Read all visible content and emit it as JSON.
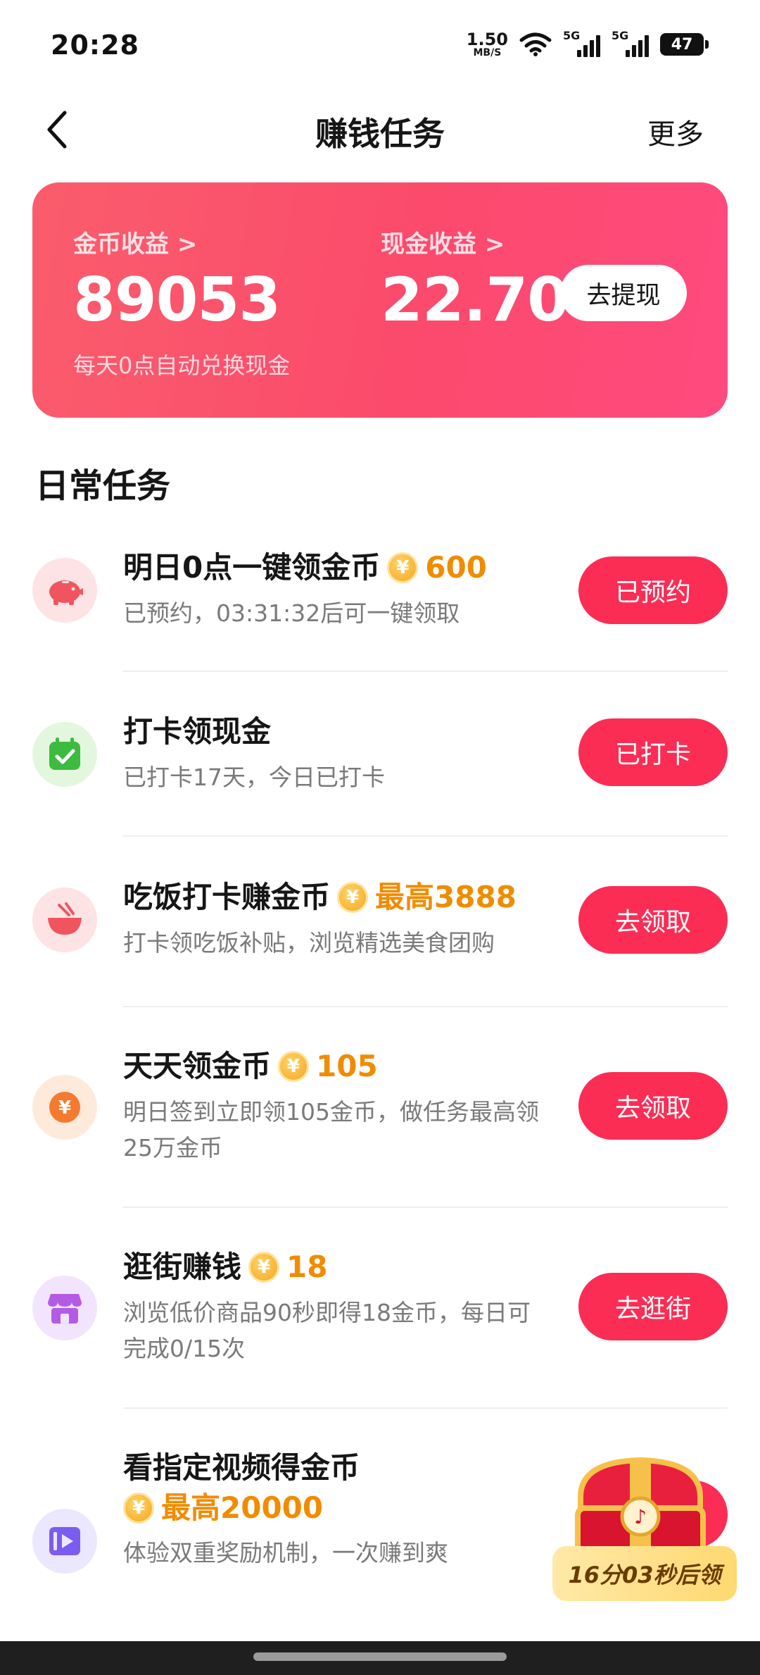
{
  "status_bar": {
    "time": "20:28",
    "net_speed_value": "1.50",
    "net_speed_unit": "MB/S",
    "sim1_label": "5G",
    "sim2_label": "5G",
    "battery": "47"
  },
  "nav": {
    "title": "赚钱任务",
    "more": "更多",
    "back_icon": "chevron-left-icon"
  },
  "earnings": {
    "coin_label": "金币收益 >",
    "coin_value": "89053",
    "cash_label": "现金收益 >",
    "cash_value": "22.70",
    "withdraw_button": "去提现",
    "note": "每天0点自动兑换现金",
    "gradient_start": "#fa5d6c",
    "gradient_end": "#ff4a7e"
  },
  "section": {
    "title": "日常任务"
  },
  "tasks": [
    {
      "icon": "piggy-bank-icon",
      "title": "明日0点一键领金币",
      "reward": "600",
      "desc": "已预约，03:31:32后可一键领取",
      "button": "已预约"
    },
    {
      "icon": "calendar-check-icon",
      "title": "打卡领现金",
      "reward": "",
      "desc": "已打卡17天，今日已打卡",
      "button": "已打卡"
    },
    {
      "icon": "rice-bowl-icon",
      "title": "吃饭打卡赚金币",
      "reward": "最高3888",
      "desc": "打卡领吃饭补贴，浏览精选美食团购",
      "button": "去领取"
    },
    {
      "icon": "yuan-coin-icon",
      "title": "天天领金币",
      "reward": "105",
      "desc": "明日签到立即领105金币，做任务最高领25万金币",
      "button": "去领取"
    },
    {
      "icon": "shop-icon",
      "title": "逛街赚钱",
      "reward": "18",
      "desc": "浏览低价商品90秒即得18金币，每日可完成0/15次",
      "button": "去逛街"
    },
    {
      "icon": "video-play-icon",
      "title": "看指定视频得金币",
      "reward": "最高20000",
      "desc": "体验双重奖励机制，一次赚到爽",
      "button": ""
    }
  ],
  "floating_chest": {
    "icon": "treasure-chest-icon",
    "timer": "16分03秒后领"
  },
  "colors": {
    "accent": "#fb2d55",
    "reward": "#f08c00"
  }
}
